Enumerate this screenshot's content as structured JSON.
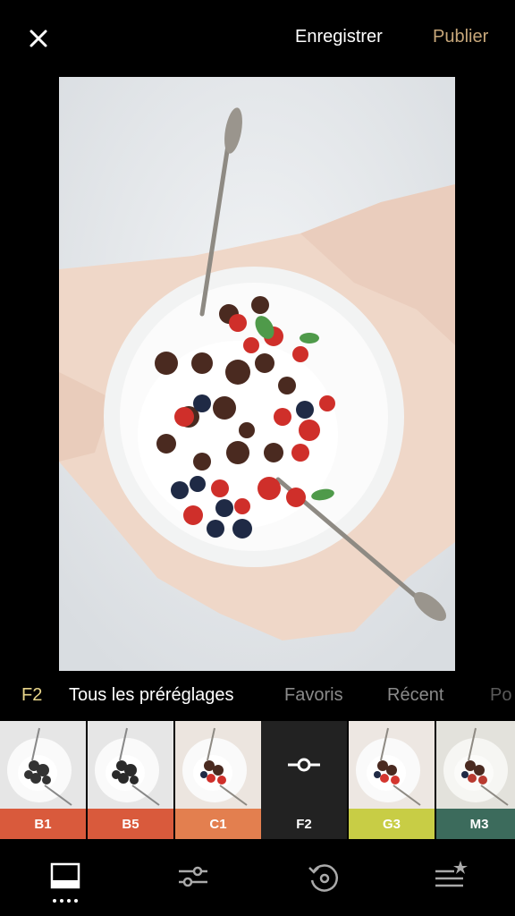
{
  "header": {
    "close_icon": "close-icon",
    "save_label": "Enregistrer",
    "publish_label": "Publier",
    "publish_color": "#c7a77a"
  },
  "tabs": {
    "current_preset": "F2",
    "all_presets": "Tous les préréglages",
    "favorites": "Favoris",
    "recent": "Récent",
    "partial": "Po"
  },
  "presets": [
    {
      "code": "B1",
      "color": "#d95a3c",
      "filter": "bw"
    },
    {
      "code": "B5",
      "color": "#d95a3c",
      "filter": "bw"
    },
    {
      "code": "C1",
      "color": "#e37f4f",
      "filter": "color"
    },
    {
      "code": "F2",
      "color": "#222222",
      "filter": "selected",
      "icon": "adjust-slider-icon"
    },
    {
      "code": "G3",
      "color": "#c8cd45",
      "filter": "color"
    },
    {
      "code": "M3",
      "color": "#3c6b5c",
      "filter": "color"
    }
  ],
  "bottom_nav": {
    "items": [
      "presets-icon",
      "adjust-icon",
      "history-icon",
      "recipes-icon"
    ]
  }
}
